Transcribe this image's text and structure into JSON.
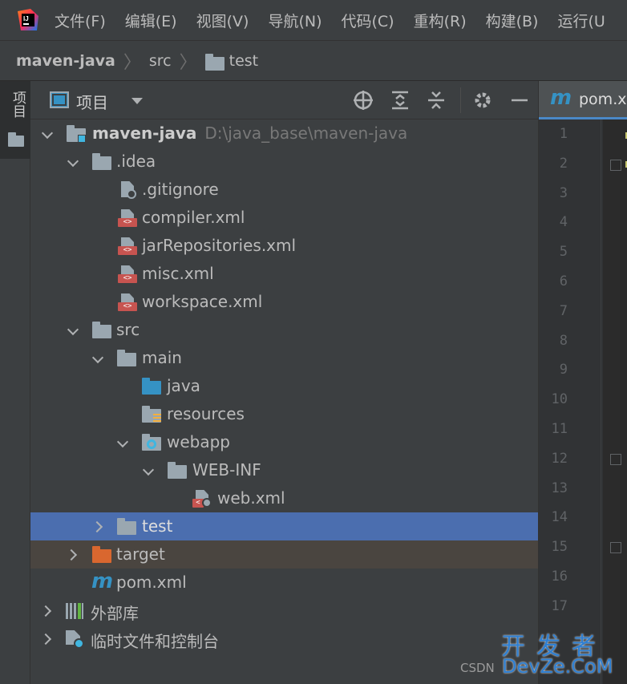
{
  "menubar": {
    "items": [
      "文件(F)",
      "编辑(E)",
      "视图(V)",
      "导航(N)",
      "代码(C)",
      "重构(R)",
      "构建(B)",
      "运行(U"
    ]
  },
  "breadcrumb": {
    "items": [
      "maven-java",
      "src",
      "test"
    ]
  },
  "stripe": {
    "project_tab_label": "项目"
  },
  "panel": {
    "title": "项目",
    "icons": [
      "locate-icon",
      "expand-all-icon",
      "collapse-all-icon",
      "settings-gear-icon",
      "hide-minus-icon"
    ]
  },
  "tree": {
    "root_label": "maven-java",
    "root_path": "D:\\java_base\\maven-java",
    "idea": ".idea",
    "gitignore": ".gitignore",
    "compiler": "compiler.xml",
    "jarrepos": "jarRepositories.xml",
    "misc": "misc.xml",
    "workspace": "workspace.xml",
    "src": "src",
    "main": "main",
    "java": "java",
    "resources": "resources",
    "webapp": "webapp",
    "webinf": "WEB-INF",
    "webxml": "web.xml",
    "test": "test",
    "target": "target",
    "pom": "pom.xml",
    "external_libs": "外部库",
    "scratches": "临时文件和控制台"
  },
  "editor": {
    "tab_label": "pom.x",
    "line_numbers": [
      "1",
      "2",
      "3",
      "4",
      "5",
      "6",
      "7",
      "8",
      "9",
      "10",
      "11",
      "12",
      "13",
      "14",
      "15",
      "16",
      "17"
    ]
  },
  "watermark": {
    "cn": "开发者",
    "en": "DevZe.CoM",
    "csdn": "CSDN"
  },
  "colors": {
    "selection": "#4b6eaf",
    "excluded_highlight": "#4a4540",
    "maven_blue": "#3592c4",
    "panel_bg": "#3c3f41"
  }
}
